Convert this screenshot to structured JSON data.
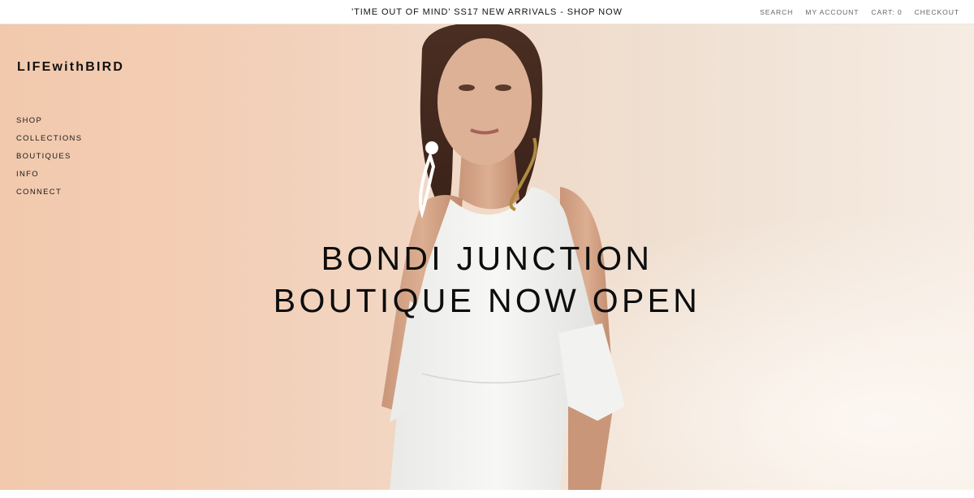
{
  "announcement": {
    "text": "'TIME OUT OF MIND' SS17 NEW ARRIVALS - SHOP NOW"
  },
  "utility_nav": {
    "search": "SEARCH",
    "account": "MY ACCOUNT",
    "cart": "CART: 0",
    "checkout": "CHECKOUT"
  },
  "brand": {
    "logo": "LIFEwithBIRD"
  },
  "main_nav": {
    "items": [
      "SHOP",
      "COLLECTIONS",
      "BOUTIQUES",
      "INFO",
      "CONNECT"
    ]
  },
  "hero": {
    "headline_line1": "BONDI JUNCTION",
    "headline_line2": "BOUTIQUE NOW OPEN"
  },
  "colors": {
    "background": "#ffffff",
    "hero_peach": "#f2c9ad",
    "text": "#111111",
    "utility_text": "#666666"
  }
}
